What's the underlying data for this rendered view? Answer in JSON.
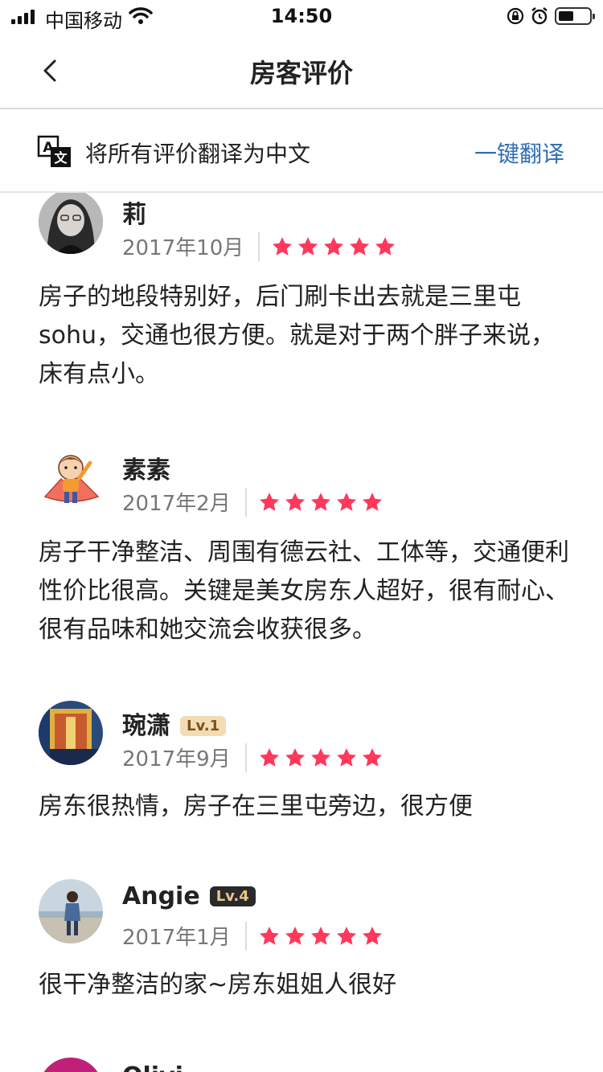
{
  "status_bar": {
    "carrier": "中国移动",
    "time": "14:50"
  },
  "nav": {
    "title": "房客评价"
  },
  "translate": {
    "text": "将所有评价翻译为中文",
    "action": "一键翻译"
  },
  "colors": {
    "star": "#ff385c",
    "link": "#2f6db5"
  },
  "reviews": [
    {
      "name": "莉",
      "date": "2017年10月",
      "rating": 5,
      "text": "房子的地段特别好，后门刷卡出去就是三里屯sohu，交通也很方便。就是对于两个胖子来说，床有点小。"
    },
    {
      "name": "素素",
      "date": "2017年2月",
      "rating": 5,
      "text": "房子干净整洁、周围有德云社、工体等，交通便利性价比很高。关键是美女房东人超好，很有耐心、很有品味和她交流会收获很多。"
    },
    {
      "name": "琬潇",
      "badge": "Lv.1",
      "date": "2017年9月",
      "rating": 5,
      "text": "房东很热情，房子在三里屯旁边，很方便"
    },
    {
      "name": "Angie",
      "badge": "Lv.4",
      "date": "2017年1月",
      "rating": 5,
      "text": "很干净整洁的家~房东姐姐人很好"
    },
    {
      "name": "Olivi"
    }
  ]
}
